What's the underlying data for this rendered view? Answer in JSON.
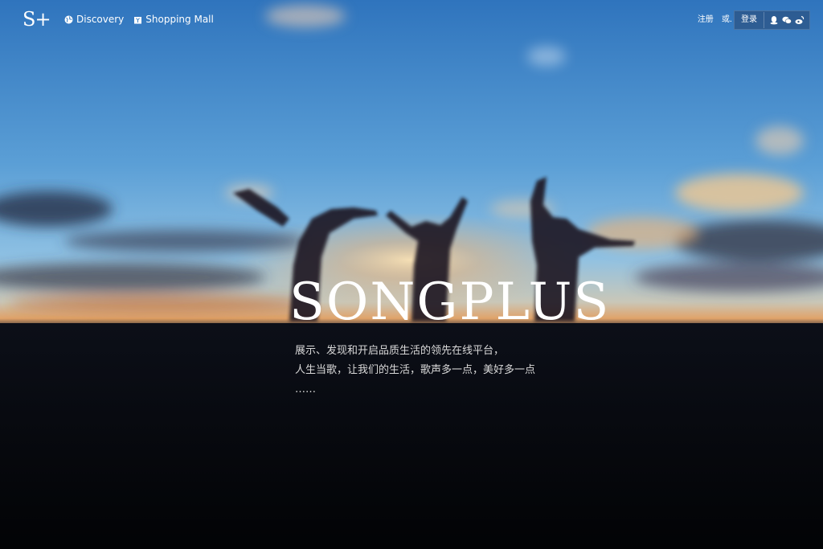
{
  "header": {
    "logo_text": "S+",
    "nav": [
      {
        "label": "Discovery",
        "icon": "globe-icon"
      },
      {
        "label": "Shopping Mall",
        "icon": "shopping-bag-icon"
      }
    ],
    "auth": {
      "register_label": "注册",
      "or_label": "或.",
      "login_label": "登录",
      "social_icons": [
        "qq-icon",
        "wechat-icon",
        "weibo-icon"
      ]
    }
  },
  "hero": {
    "title": "SONGPLUS",
    "tagline_lines": [
      "展示、发现和开启品质生活的领先在线平台，",
      "人生当歌，让我们的生活，歌声多一点，美好多一点",
      "……"
    ]
  },
  "colors": {
    "sky_top": "#3a7fc4",
    "sky_mid": "#7fb8e0",
    "horizon_glow": "#e8a060",
    "ground": "#05070c"
  }
}
